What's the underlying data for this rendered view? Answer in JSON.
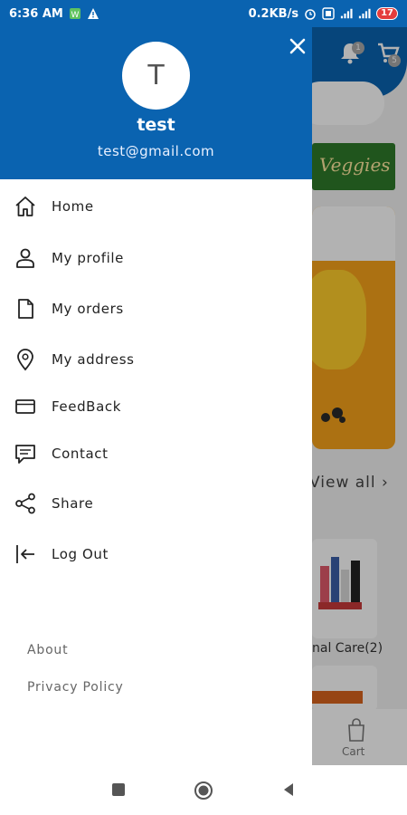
{
  "status_bar": {
    "time": "6:36 AM",
    "speed": "0.2KB/s",
    "battery": "17"
  },
  "drawer": {
    "avatar_initial": "T",
    "user_name": "test",
    "user_email": "test@gmail.com",
    "menu": [
      {
        "label": "Home",
        "icon": "home-icon"
      },
      {
        "label": "My profile",
        "icon": "person-icon"
      },
      {
        "label": "My orders",
        "icon": "document-icon"
      },
      {
        "label": "My address",
        "icon": "location-pin-icon"
      },
      {
        "label": "FeedBack",
        "icon": "card-icon"
      },
      {
        "label": "Contact",
        "icon": "chat-icon"
      },
      {
        "label": "Share",
        "icon": "share-icon"
      },
      {
        "label": "Log Out",
        "icon": "logout-icon"
      }
    ],
    "links": {
      "about": "About",
      "privacy": "Privacy Policy"
    }
  },
  "background": {
    "veggies_banner": "Veggies",
    "view_all": "View all",
    "category_label": "nal Care(2)",
    "cart_label": "Cart",
    "bell_badge": "1",
    "cart_badge": "5"
  },
  "colors": {
    "primary": "#0a63b0"
  }
}
